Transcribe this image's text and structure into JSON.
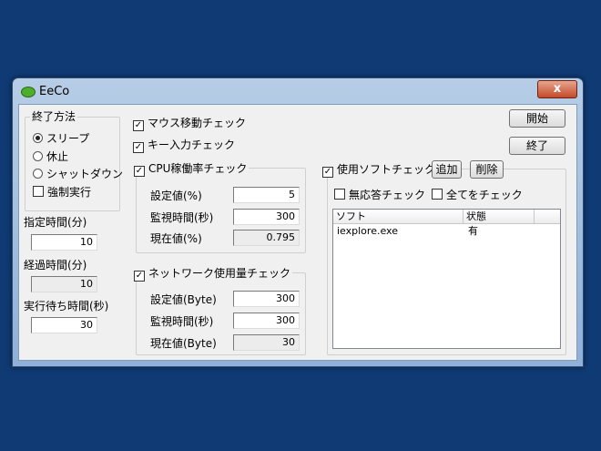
{
  "window": {
    "title": "EeCo",
    "close_symbol": "x"
  },
  "end_method": {
    "legend": "終了方法",
    "options": [
      "スリープ",
      "休止",
      "シャットダウン"
    ],
    "selected": 0,
    "force": {
      "label": "強制実行",
      "checked": false
    }
  },
  "specified_time": {
    "label": "指定時間(分)",
    "value": "10"
  },
  "elapsed_time": {
    "label": "経過時間(分)",
    "value": "10"
  },
  "wait_time": {
    "label": "実行待ち時間(秒)",
    "value": "30"
  },
  "mouse_check": {
    "label": "マウス移動チェック",
    "checked": true
  },
  "key_check": {
    "label": "キー入力チェック",
    "checked": true
  },
  "cpu": {
    "legend": "CPU稼働率チェック",
    "checked": true,
    "set_label": "設定値(%)",
    "set_value": "5",
    "watch_label": "監視時間(秒)",
    "watch_value": "300",
    "current_label": "現在値(%)",
    "current_value": "0.795"
  },
  "network": {
    "legend": "ネットワーク使用量チェック",
    "checked": true,
    "set_label": "設定値(Byte)",
    "set_value": "300",
    "watch_label": "監視時間(秒)",
    "watch_value": "300",
    "current_label": "現在値(Byte)",
    "current_value": "30"
  },
  "buttons": {
    "start": "開始",
    "end": "終了",
    "add": "追加",
    "delete": "削除"
  },
  "software": {
    "legend": "使用ソフトチェック",
    "checked": true,
    "no_response": {
      "label": "無応答チェック",
      "checked": false
    },
    "check_all": {
      "label": "全てをチェック",
      "checked": false
    },
    "columns": [
      "ソフト",
      "状態"
    ],
    "rows": [
      {
        "name": "iexplore.exe",
        "status": "有"
      }
    ]
  }
}
